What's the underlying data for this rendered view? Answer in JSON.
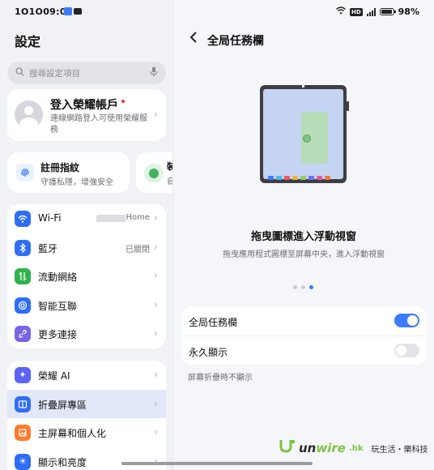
{
  "status_bar": {
    "time": "1O1O09:05",
    "battery": "98%",
    "battery_level": 0.98
  },
  "left": {
    "title": "設定",
    "search_placeholder": "搜尋設定項目",
    "account": {
      "title": "登入榮耀帳戶",
      "subtitle": "連線網路登入可使用榮耀服務"
    },
    "cards": [
      {
        "title": "註冊指紋",
        "subtitle": "守護私隱，增強安全"
      },
      {
        "title": "裝",
        "subtitle": "自"
      }
    ],
    "group1": [
      {
        "label": "Wi-Fi",
        "value": "Home",
        "icon": "wifi-icon",
        "color": "#2f6df6"
      },
      {
        "label": "藍牙",
        "value": "已關閉",
        "icon": "bluetooth-icon",
        "color": "#2f6df6"
      },
      {
        "label": "流動網絡",
        "value": "",
        "icon": "mobile-data-icon",
        "color": "#2fb24c"
      },
      {
        "label": "智能互聯",
        "value": "",
        "icon": "smart-connect-icon",
        "color": "#2f6df6"
      },
      {
        "label": "更多連接",
        "value": "",
        "icon": "link-icon",
        "color": "#7a64e6"
      }
    ],
    "group2": [
      {
        "label": "榮耀 AI",
        "icon": "ai-icon",
        "color": "#5b63f5"
      },
      {
        "label": "折疊屏專區",
        "icon": "fold-icon",
        "color": "#2f6df6"
      },
      {
        "label": "主屏幕和個人化",
        "icon": "home-screen-icon",
        "color": "#ff7a2f"
      },
      {
        "label": "顯示和亮度",
        "icon": "brightness-icon",
        "color": "#2f6df6"
      }
    ]
  },
  "right": {
    "title": "全局任務欄",
    "illustration_title": "拖曳圖標進入浮動視窗",
    "illustration_subtitle": "拖曳應用程式圖標至屏幕中央，進入浮動視窗",
    "page_indicator": {
      "count": 3,
      "active": 3
    },
    "settings": [
      {
        "label": "全局任務欄",
        "enabled": true
      },
      {
        "label": "永久顯示",
        "enabled": false
      }
    ],
    "hint": "屏幕折疊時不顯示"
  },
  "watermark": {
    "logo_a": "un",
    "logo_b": "wire",
    "domain": ".hk",
    "slogan": "玩生活・樂科技"
  },
  "colors": {
    "accent": "#3b7cff",
    "badge_red": "#e53935"
  }
}
